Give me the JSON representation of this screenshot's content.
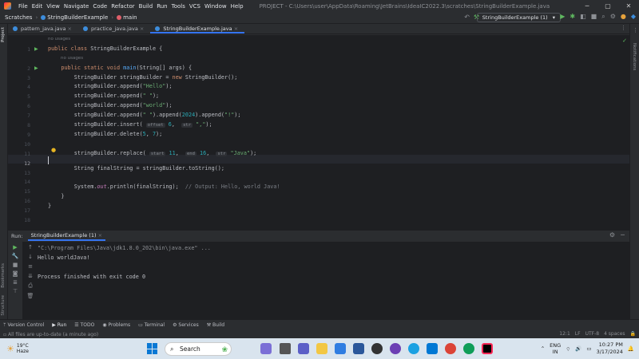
{
  "menu": [
    "File",
    "Edit",
    "View",
    "Navigate",
    "Code",
    "Refactor",
    "Build",
    "Run",
    "Tools",
    "VCS",
    "Window",
    "Help"
  ],
  "window_title": "PROJECT - C:\\Users\\user\\AppData\\Roaming\\JetBrains\\IdeaIC2022.3\\scratches\\StringBuilderExample.java",
  "breadcrumbs": [
    "Scratches",
    "StringBuilderExample",
    "main"
  ],
  "run_config": "StringBuilderExample (1)",
  "side_labels": {
    "project": "Project",
    "bookmarks": "Bookmarks",
    "structure": "Structure",
    "notifications": "Notifications"
  },
  "tabs": [
    "pattern_java.java",
    "practice_java.java",
    "StringBuilderExample.java"
  ],
  "inlay_hint": "no usages",
  "code_lines": [
    {
      "n": "1",
      "text": "public class StringBuilderExample {"
    },
    {
      "n": "2",
      "text": "    public static void main(String[] args) {"
    },
    {
      "n": "3",
      "text": "        StringBuilder stringBuilder = new StringBuilder();"
    },
    {
      "n": "4",
      "text": "        stringBuilder.append(\"Hello\");"
    },
    {
      "n": "5",
      "text": "        stringBuilder.append(\" \");"
    },
    {
      "n": "6",
      "text": "        stringBuilder.append(\"world\");"
    },
    {
      "n": "7",
      "text": "        stringBuilder.append(\" \").append(2024).append(\"!\");"
    },
    {
      "n": "8",
      "text": "        stringBuilder.insert(6, \",\");"
    },
    {
      "n": "9",
      "text": "        stringBuilder.delete(5, 7);"
    },
    {
      "n": "10",
      "text": ""
    },
    {
      "n": "11",
      "text": "        stringBuilder.replace(11, 16, \"Java\");"
    },
    {
      "n": "12",
      "text": ""
    },
    {
      "n": "13",
      "text": "        String finalString = stringBuilder.toString();"
    },
    {
      "n": "14",
      "text": ""
    },
    {
      "n": "15",
      "text": "        System.out.println(finalString);  // Output: Hello, world Java!"
    },
    {
      "n": "16",
      "text": "    }"
    },
    {
      "n": "17",
      "text": "}"
    },
    {
      "n": "18",
      "text": ""
    }
  ],
  "param_hints": {
    "offset": "offset",
    "str": "str",
    "start": "start",
    "end": "end"
  },
  "run_panel": {
    "label": "Run:",
    "tab": "StringBuilderExample (1)",
    "console": [
      "\"C:\\Program Files\\Java\\jdk1.8.0_202\\bin\\java.exe\" ...",
      "Hello worldJava!",
      "",
      "Process finished with exit code 0"
    ]
  },
  "tool_windows": [
    "Version Control",
    "Run",
    "TODO",
    "Problems",
    "Terminal",
    "Services",
    "Build"
  ],
  "status": {
    "message": "All files are up-to-date (a minute ago)",
    "position": "12:1",
    "line_sep": "LF",
    "encoding": "UTF-8",
    "indent": "4 spaces"
  },
  "taskbar": {
    "weather_temp": "19°C",
    "weather_desc": "Haze",
    "search_placeholder": "Search",
    "lang": "ENG",
    "region": "IN",
    "time": "10:27 PM",
    "date": "3/17/2024"
  }
}
